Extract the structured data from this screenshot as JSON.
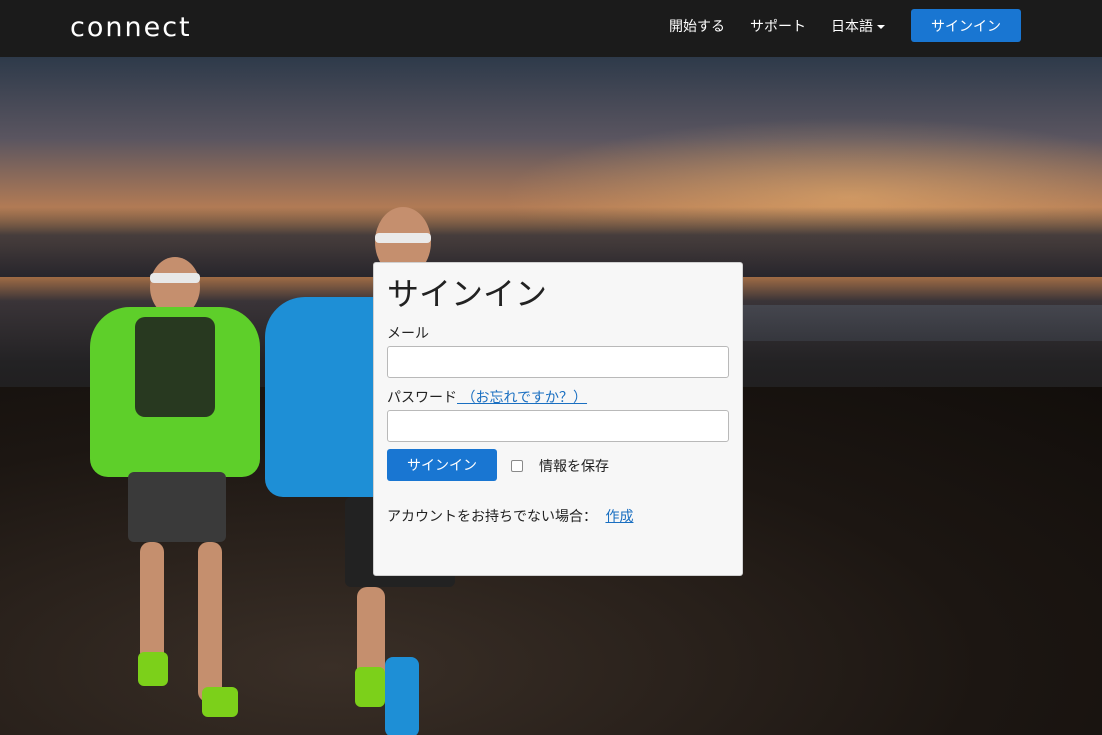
{
  "navbar": {
    "logo_text": "connect",
    "items": [
      {
        "label": "開始する"
      },
      {
        "label": "サポート"
      },
      {
        "label": "日本語"
      }
    ],
    "signin_label": "サインイン"
  },
  "signin_card": {
    "title": "サインイン",
    "email_label": "メール",
    "email_value": "",
    "password_label": "パスワード",
    "forgot_link": " （お忘れですか？）",
    "password_value": "",
    "submit_label": "サインイン",
    "remember_label": "情報を保存",
    "remember_checked": false,
    "no_account_text": "アカウントをお持ちでない場合：",
    "create_link": "作成"
  },
  "colors": {
    "navbar_bg": "#1b1b1b",
    "primary_button": "#1976d2",
    "link": "#1a6fc1",
    "card_bg": "#f7f7f7"
  }
}
